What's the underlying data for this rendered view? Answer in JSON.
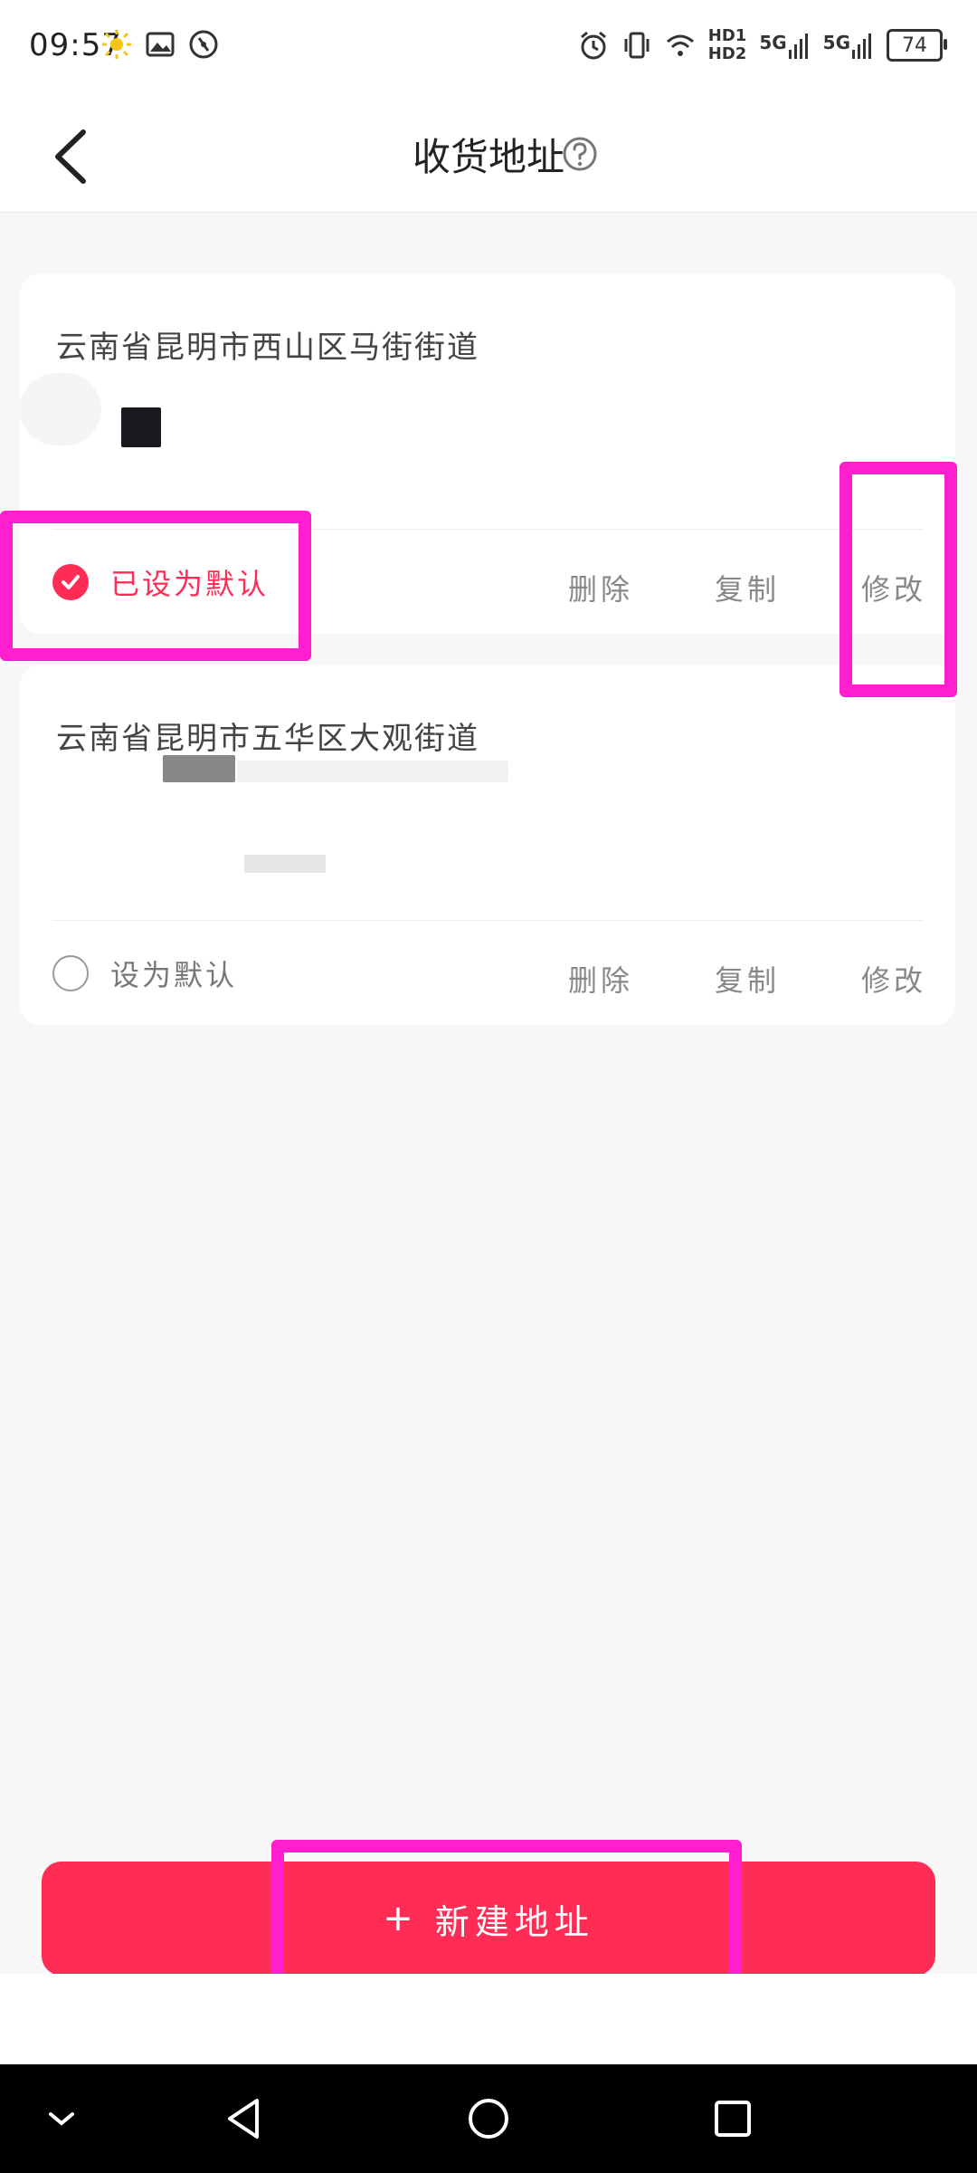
{
  "status_bar": {
    "time": "09:57",
    "network_labels": [
      "HD1",
      "HD2",
      "5G",
      "5G"
    ],
    "battery": "74"
  },
  "header": {
    "title": "收货地址"
  },
  "addresses": [
    {
      "region": "云南省昆明市西山区马街街道",
      "is_default": true,
      "default_label": "已设为默认"
    },
    {
      "region": "云南省昆明市五华区大观街道",
      "is_default": false,
      "default_label": "设为默认"
    }
  ],
  "actions": {
    "delete": "删除",
    "copy": "复制",
    "edit": "修改"
  },
  "bottom": {
    "new_address_plus": "+",
    "new_address_label": "新建地址"
  },
  "colors": {
    "accent": "#ff2d55",
    "highlight": "#ff1fcf"
  }
}
